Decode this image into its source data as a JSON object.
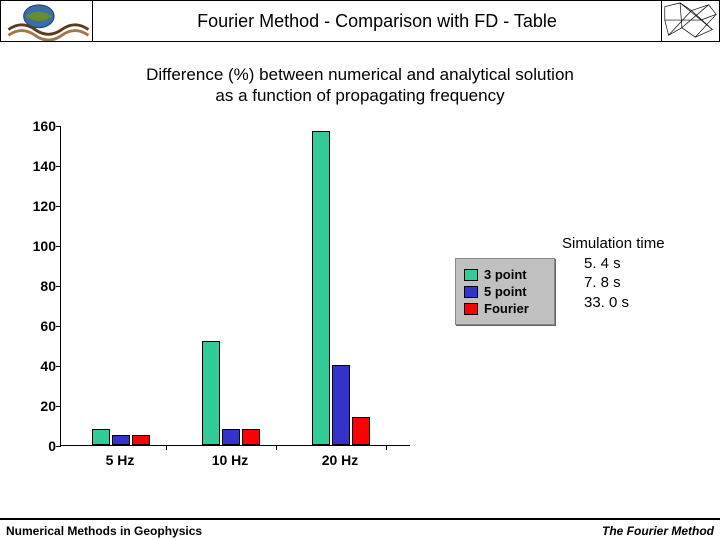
{
  "title": "Fourier Method - Comparison with FD - Table",
  "subtitle_line1": "Difference (%) between numerical  and analytical solution",
  "subtitle_line2": "as a function of propagating frequency",
  "footer_left": "Numerical Methods in Geophysics",
  "footer_right": "The Fourier Method",
  "legend": {
    "items": [
      {
        "label": "3 point",
        "color": "#33cc99"
      },
      {
        "label": "5 point",
        "color": "#3333cc"
      },
      {
        "label": "Fourier",
        "color": "#ff0000"
      }
    ]
  },
  "simulation_time": {
    "heading": "Simulation time",
    "rows": [
      "5. 4 s",
      "7. 8 s",
      "33. 0 s"
    ]
  },
  "chart_data": {
    "type": "bar",
    "title": "Difference (%) between numerical and analytical solution as a function of propagating frequency",
    "xlabel": "",
    "ylabel": "",
    "categories": [
      "5 Hz",
      "10 Hz",
      "20 Hz"
    ],
    "series": [
      {
        "name": "3 point",
        "values": [
          8,
          52,
          157
        ]
      },
      {
        "name": "5 point",
        "values": [
          5,
          8,
          40
        ]
      },
      {
        "name": "Fourier",
        "values": [
          5,
          8,
          14
        ]
      }
    ],
    "ylim": [
      0,
      160
    ],
    "yticks": [
      0,
      20,
      40,
      60,
      80,
      100,
      120,
      140,
      160
    ],
    "colors": [
      "#33cc99",
      "#3333cc",
      "#ff0000"
    ]
  }
}
